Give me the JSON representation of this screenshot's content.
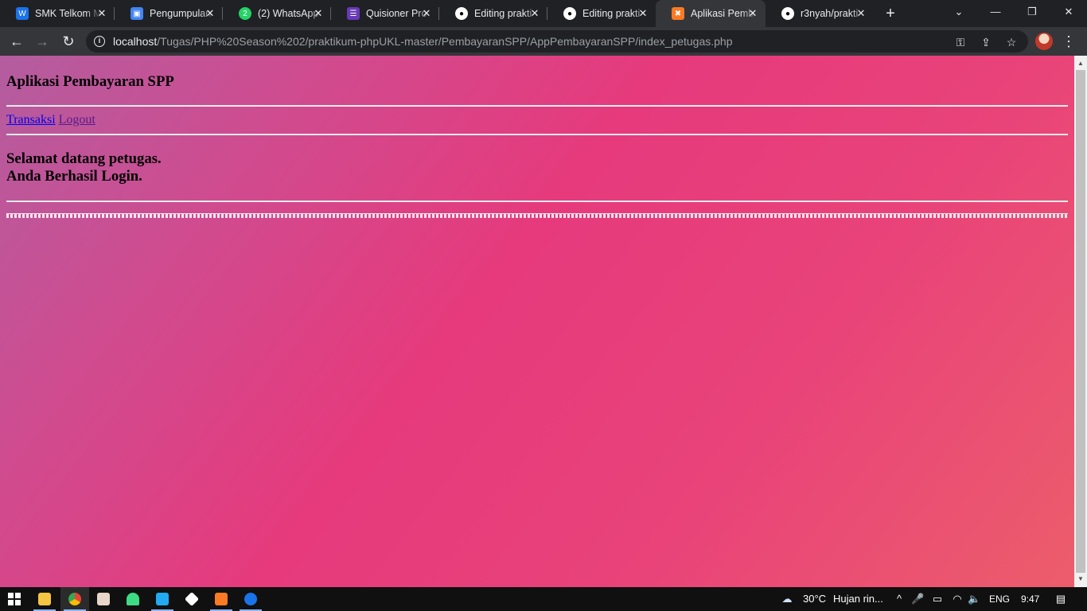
{
  "tabs": [
    {
      "title": "SMK Telkom M",
      "icon": "webex-icon",
      "color": "#1a73e8"
    },
    {
      "title": "Pengumpulan",
      "icon": "classroom-icon",
      "color": "#4285f4"
    },
    {
      "title": "(2) WhatsApp",
      "icon": "whatsapp-icon",
      "color": "#25d366"
    },
    {
      "title": "Quisioner Pro",
      "icon": "forms-icon",
      "color": "#673ab7"
    },
    {
      "title": "Editing prakti",
      "icon": "github-icon",
      "color": "#ffffff"
    },
    {
      "title": "Editing prakti",
      "icon": "github-icon",
      "color": "#ffffff"
    },
    {
      "title": "Aplikasi Pemb",
      "icon": "xampp-icon",
      "color": "#fb7a24"
    },
    {
      "title": "r3nyah/prakti",
      "icon": "github-icon",
      "color": "#ffffff"
    }
  ],
  "browser": {
    "url_host": "localhost",
    "url_path": "/Tugas/PHP%20Season%202/praktikum-phpUKL-master/PembayaranSPP/AppPembayaranSPP/index_petugas.php"
  },
  "page": {
    "title": "Aplikasi Pembayaran SPP",
    "nav": {
      "transaksi": "Transaksi",
      "logout": "Logout"
    },
    "welcome_line1": "Selamat datang petugas.",
    "welcome_line2": "Anda Berhasil Login."
  },
  "taskbar": {
    "weather_temp": "30°C",
    "weather_desc": "Hujan rin...",
    "language": "ENG",
    "time": "9:47"
  },
  "colors": {
    "gradient_start": "#b35d9f",
    "gradient_mid": "#e63a7c",
    "gradient_end": "#ec5d6b"
  }
}
